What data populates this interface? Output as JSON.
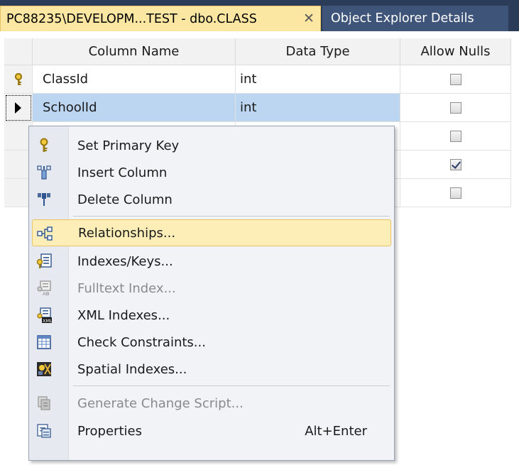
{
  "tabs": {
    "active": {
      "label": "PC88235\\DEVELOPM...TEST - dbo.CLASS",
      "close_glyph": "✕"
    },
    "inactive": {
      "label": "Object Explorer Details"
    }
  },
  "grid": {
    "headers": {
      "name": "Column Name",
      "type": "Data Type",
      "nulls": "Allow Nulls"
    },
    "rows": [
      {
        "name": "ClassId",
        "type": "int",
        "allow_nulls": false,
        "marker": "key-icon"
      },
      {
        "name": "SchoolId",
        "type": "int",
        "allow_nulls": false,
        "marker": "current-row-arrow-icon",
        "selected": true
      },
      {
        "name": "",
        "type": "",
        "allow_nulls": false
      },
      {
        "name": "",
        "type": "",
        "allow_nulls": true
      },
      {
        "name": "",
        "type": "",
        "allow_nulls": false
      }
    ]
  },
  "menu": {
    "items": [
      {
        "label": "Set Primary Key",
        "icon": "primary-key-icon"
      },
      {
        "label": "Insert Column",
        "icon": "insert-column-icon"
      },
      {
        "label": "Delete Column",
        "icon": "delete-column-icon"
      },
      {
        "label": "Relationships...",
        "icon": "relationships-icon",
        "hover": true
      },
      {
        "label": "Indexes/Keys...",
        "icon": "indexes-keys-icon"
      },
      {
        "label": "Fulltext Index...",
        "icon": "fulltext-index-icon",
        "disabled": true
      },
      {
        "label": "XML Indexes...",
        "icon": "xml-indexes-icon"
      },
      {
        "label": "Check Constraints...",
        "icon": "check-constraints-icon"
      },
      {
        "label": "Spatial Indexes...",
        "icon": "spatial-indexes-icon"
      },
      {
        "label": "Generate Change Script...",
        "icon": "generate-script-icon",
        "disabled": true
      },
      {
        "label": "Properties",
        "icon": "properties-icon",
        "shortcut": "Alt+Enter"
      }
    ]
  },
  "colors": {
    "tab_active_bg": "#fbe6a2",
    "tab_strip_bg": "#2b3c59",
    "row_selected_bg": "#bcd6f1",
    "menu_hover_bg": "#fdeeb8"
  }
}
